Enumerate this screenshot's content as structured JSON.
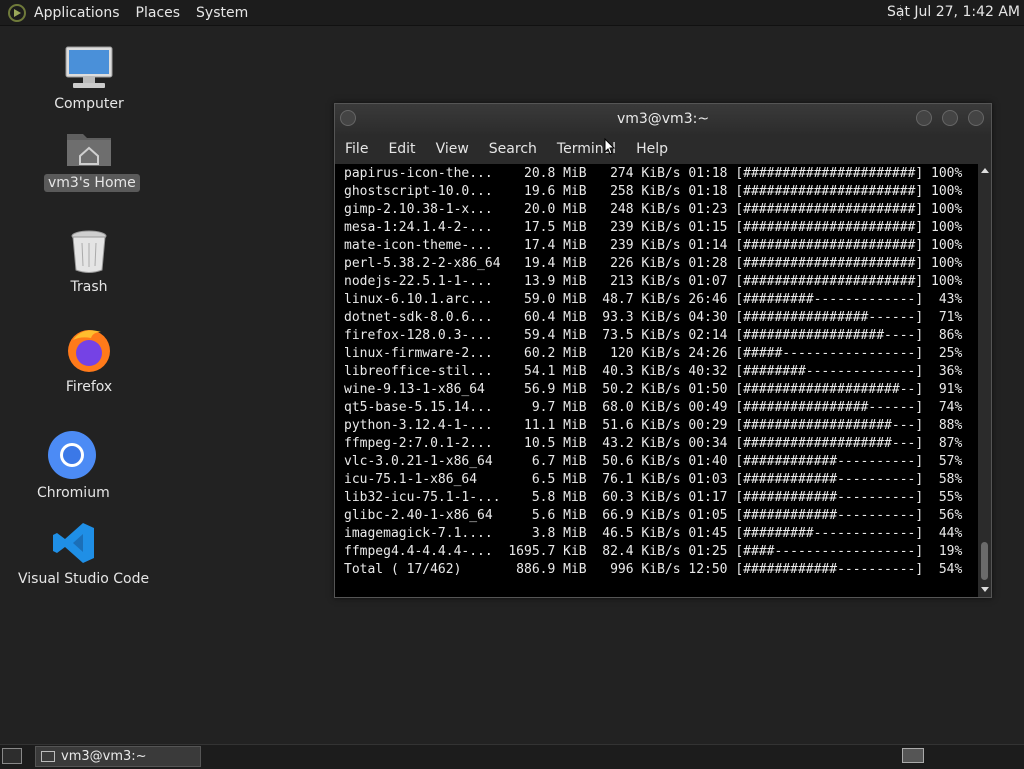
{
  "top_panel": {
    "menus": [
      "Applications",
      "Places",
      "System"
    ],
    "clock": "Sat Jul 27,  1:42 AM"
  },
  "desktop": {
    "icons": [
      {
        "label": "Computer",
        "icon": "computer-icon"
      },
      {
        "label": "vm3's Home",
        "icon": "home-folder-icon"
      },
      {
        "label": "Trash",
        "icon": "trash-icon"
      },
      {
        "label": "Firefox",
        "icon": "firefox-icon"
      },
      {
        "label": "Chromium",
        "icon": "chromium-icon"
      },
      {
        "label": "Visual Studio Code",
        "icon": "vscode-icon"
      }
    ]
  },
  "terminal": {
    "title": "vm3@vm3:~",
    "menu": [
      "File",
      "Edit",
      "View",
      "Search",
      "Terminal",
      "Help"
    ],
    "lines": [
      "papirus-icon-the...    20.8 MiB   274 KiB/s 01:18 [######################] 100%",
      "ghostscript-10.0...    19.6 MiB   258 KiB/s 01:18 [######################] 100%",
      "gimp-2.10.38-1-x...    20.0 MiB   248 KiB/s 01:23 [######################] 100%",
      "mesa-1:24.1.4-2-...    17.5 MiB   239 KiB/s 01:15 [######################] 100%",
      "mate-icon-theme-...    17.4 MiB   239 KiB/s 01:14 [######################] 100%",
      "perl-5.38.2-2-x86_64   19.4 MiB   226 KiB/s 01:28 [######################] 100%",
      "nodejs-22.5.1-1-...    13.9 MiB   213 KiB/s 01:07 [######################] 100%",
      "linux-6.10.1.arc...    59.0 MiB  48.7 KiB/s 26:46 [#########-------------]  43%",
      "dotnet-sdk-8.0.6...    60.4 MiB  93.3 KiB/s 04:30 [################------]  71%",
      "firefox-128.0.3-...    59.4 MiB  73.5 KiB/s 02:14 [##################----]  86%",
      "linux-firmware-2...    60.2 MiB   120 KiB/s 24:26 [#####-----------------]  25%",
      "libreoffice-stil...    54.1 MiB  40.3 KiB/s 40:32 [########--------------]  36%",
      "wine-9.13-1-x86_64     56.9 MiB  50.2 KiB/s 01:50 [####################--]  91%",
      "qt5-base-5.15.14...     9.7 MiB  68.0 KiB/s 00:49 [################------]  74%",
      "python-3.12.4-1-...    11.1 MiB  51.6 KiB/s 00:29 [###################---]  88%",
      "ffmpeg-2:7.0.1-2...    10.5 MiB  43.2 KiB/s 00:34 [###################---]  87%",
      "vlc-3.0.21-1-x86_64     6.7 MiB  50.6 KiB/s 01:40 [############----------]  57%",
      "icu-75.1-1-x86_64       6.5 MiB  76.1 KiB/s 01:03 [############----------]  58%",
      "lib32-icu-75.1-1-...    5.8 MiB  60.3 KiB/s 01:17 [############----------]  55%",
      "glibc-2.40-1-x86_64     5.6 MiB  66.9 KiB/s 01:05 [############----------]  56%",
      "imagemagick-7.1....     3.8 MiB  46.5 KiB/s 01:45 [#########-------------]  44%",
      "ffmpeg4.4-4.4.4-...  1695.7 KiB  82.4 KiB/s 01:25 [####------------------]  19%",
      "Total ( 17/462)       886.9 MiB   996 KiB/s 12:50 [############----------]  54%"
    ]
  },
  "taskbar": {
    "window_label": "vm3@vm3:~"
  }
}
